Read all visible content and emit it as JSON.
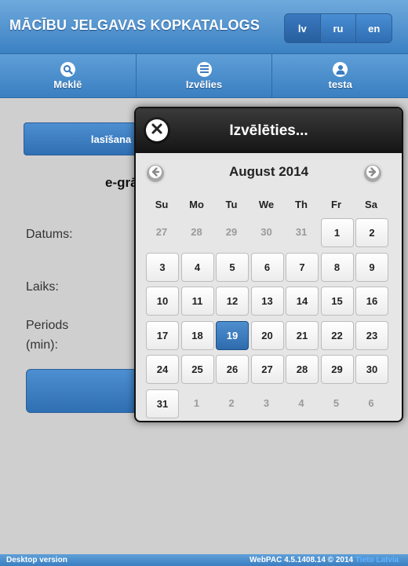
{
  "header": {
    "title": "MĀCĪBU JELGAVAS KOPKATALOGS",
    "languages": [
      "lv",
      "ru",
      "en"
    ]
  },
  "nav": {
    "items": [
      {
        "label": "Meklē",
        "icon": "search-icon"
      },
      {
        "label": "Izvēlies",
        "icon": "menu-list-icon"
      },
      {
        "label": "testa",
        "icon": "user-icon"
      }
    ]
  },
  "content": {
    "top_button": "lasīšana uz v",
    "heading": "e-grā",
    "labels": {
      "date": "Datums:",
      "time": "Laiks:",
      "period_line1": "Periods",
      "period_line2": "(min):"
    }
  },
  "datepicker": {
    "title": "Izvēlēties...",
    "month": "August 2014",
    "weekdays": [
      "Su",
      "Mo",
      "Tu",
      "We",
      "Th",
      "Fr",
      "Sa"
    ],
    "weeks": [
      [
        [
          "27",
          0
        ],
        [
          "28",
          0
        ],
        [
          "29",
          0
        ],
        [
          "30",
          0
        ],
        [
          "31",
          0
        ],
        [
          "1",
          1
        ],
        [
          "2",
          1
        ]
      ],
      [
        [
          "3",
          1
        ],
        [
          "4",
          1
        ],
        [
          "5",
          1
        ],
        [
          "6",
          1
        ],
        [
          "7",
          1
        ],
        [
          "8",
          1
        ],
        [
          "9",
          1
        ]
      ],
      [
        [
          "10",
          1
        ],
        [
          "11",
          1
        ],
        [
          "12",
          1
        ],
        [
          "13",
          1
        ],
        [
          "14",
          1
        ],
        [
          "15",
          1
        ],
        [
          "16",
          1
        ]
      ],
      [
        [
          "17",
          1
        ],
        [
          "18",
          1
        ],
        [
          "19",
          2
        ],
        [
          "20",
          1
        ],
        [
          "21",
          1
        ],
        [
          "22",
          1
        ],
        [
          "23",
          1
        ]
      ],
      [
        [
          "24",
          1
        ],
        [
          "25",
          1
        ],
        [
          "26",
          1
        ],
        [
          "27",
          1
        ],
        [
          "28",
          1
        ],
        [
          "29",
          1
        ],
        [
          "30",
          1
        ]
      ],
      [
        [
          "31",
          1
        ],
        [
          "1",
          0
        ],
        [
          "2",
          0
        ],
        [
          "3",
          0
        ],
        [
          "4",
          0
        ],
        [
          "5",
          0
        ],
        [
          "6",
          0
        ]
      ]
    ]
  },
  "footer": {
    "left": "Desktop version",
    "right": "WebPAC 4.5.1408.14 © 2014",
    "brand": "Tieto Latvia"
  },
  "colors": {
    "header_blue": "#3b81c3",
    "selected_day": "#2e6bad",
    "dialog_header": "#141414"
  }
}
